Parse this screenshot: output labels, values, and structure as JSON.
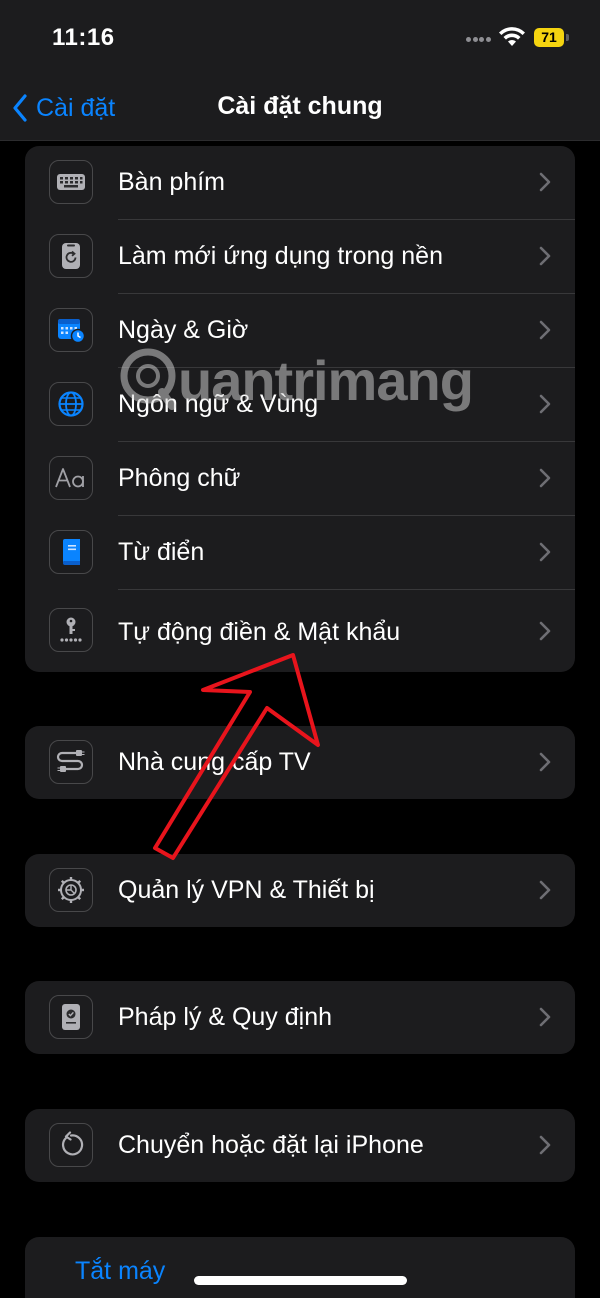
{
  "status_bar": {
    "time": "11:16",
    "battery_level": "71",
    "battery_color": "#f5d410",
    "icons": [
      "signal-dots-icon",
      "wifi-icon",
      "battery-icon"
    ]
  },
  "nav": {
    "back_label": "Cài đặt",
    "title": "Cài đặt chung",
    "accent_color": "#0a84ff"
  },
  "groups": [
    {
      "items": [
        {
          "label": "Bàn phím",
          "icon": "keyboard-icon"
        },
        {
          "label": "Làm mới ứng dụng trong nền",
          "icon": "background-refresh-icon"
        },
        {
          "label": "Ngày & Giờ",
          "icon": "calendar-clock-icon"
        },
        {
          "label": "Ngôn ngữ & Vùng",
          "icon": "globe-icon"
        },
        {
          "label": "Phông chữ",
          "icon": "font-aa-icon"
        },
        {
          "label": "Từ điển",
          "icon": "book-icon"
        },
        {
          "label": "Tự động điền & Mật khẩu",
          "icon": "key-icon"
        }
      ]
    },
    {
      "items": [
        {
          "label": "Nhà cung cấp TV",
          "icon": "tv-provider-icon"
        }
      ]
    },
    {
      "items": [
        {
          "label": "Quản lý VPN & Thiết bị",
          "icon": "gear-icon"
        }
      ]
    },
    {
      "items": [
        {
          "label": "Pháp lý & Quy định",
          "icon": "legal-document-icon"
        }
      ]
    },
    {
      "items": [
        {
          "label": "Chuyển hoặc đặt lại iPhone",
          "icon": "reset-icon"
        }
      ]
    }
  ],
  "shutdown_label": "Tắt máy",
  "watermark": {
    "text": "uantrimang"
  },
  "annotation": {
    "color": "#e8141c",
    "icon": "red-arrow-icon"
  }
}
